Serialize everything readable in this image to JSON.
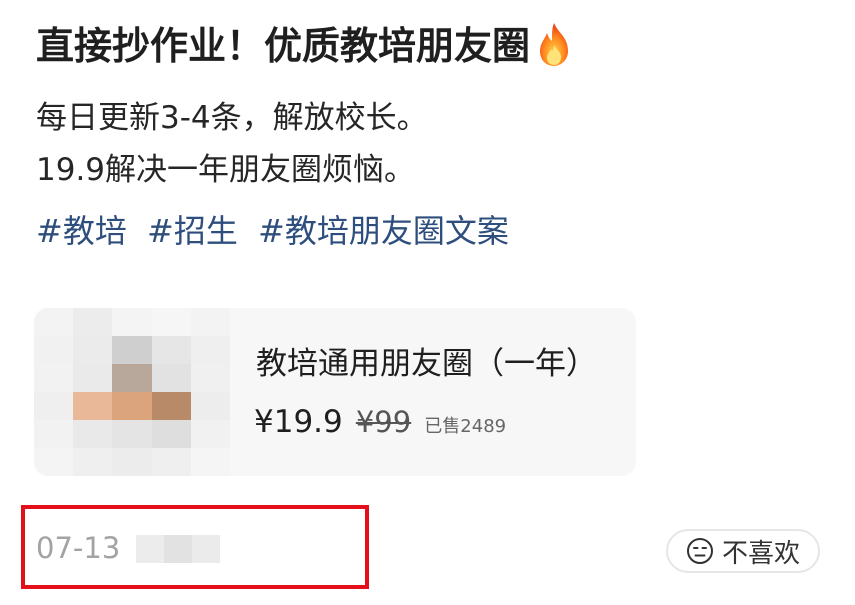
{
  "post": {
    "title": "直接抄作业！优质教培朋友圈",
    "title_icon": "fire-icon",
    "body_lines": [
      "每日更新3-4条，解放校长。",
      "19.9解决一年朋友圈烦恼。"
    ],
    "tags": [
      "#教培",
      "#招生",
      "#教培朋友圈文案"
    ]
  },
  "product": {
    "name": "教培通用朋友圈（一年）",
    "price": "¥19.9",
    "original_price": "¥99",
    "sold_label": "已售",
    "sold_count": "2489"
  },
  "footer": {
    "date": "07-13",
    "dislike_label": "不喜欢",
    "dislike_icon": "neutral-face-icon"
  },
  "colors": {
    "tag": "#2e4f7e",
    "highlight_border": "#e3101b",
    "date": "#a3a3a3",
    "card_bg": "#f7f7f7"
  }
}
